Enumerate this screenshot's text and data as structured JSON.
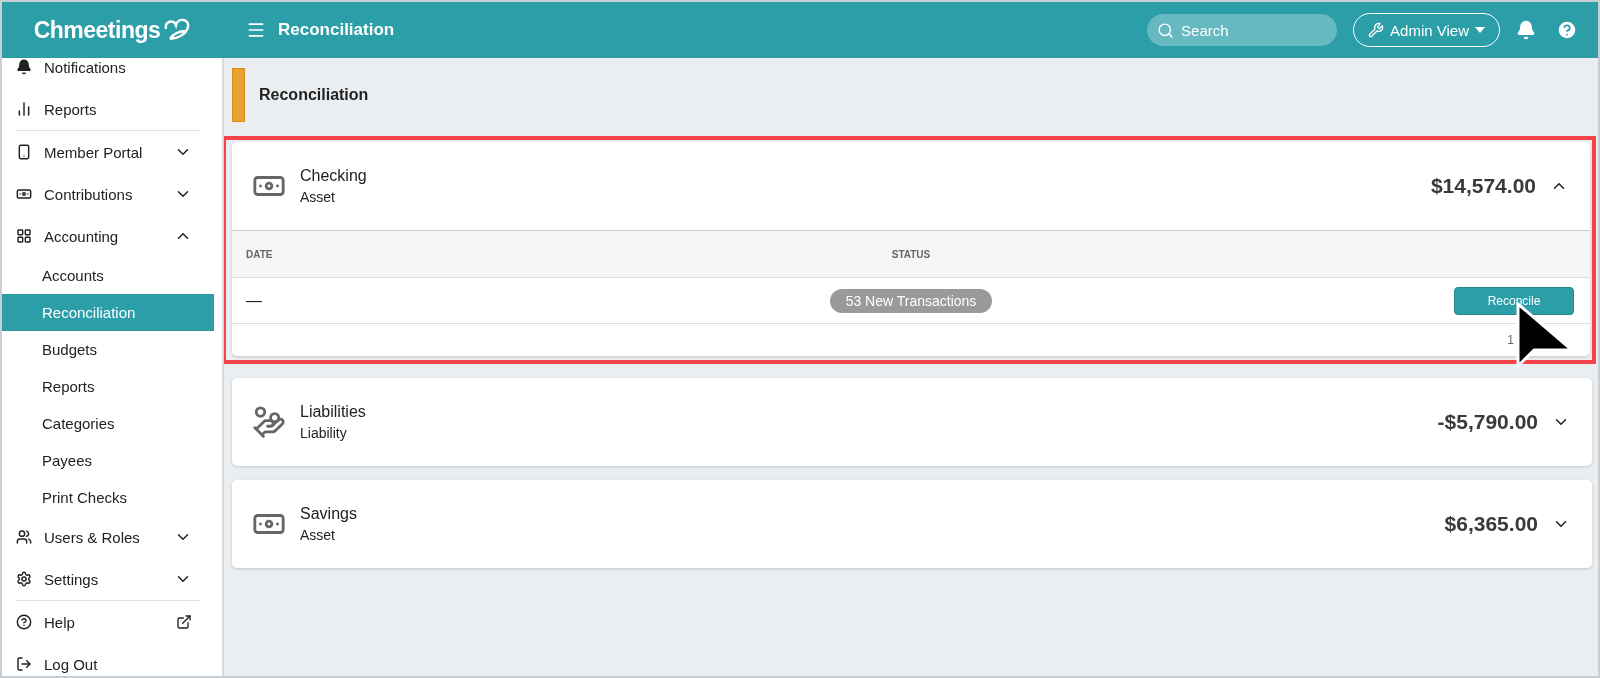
{
  "brand": {
    "name": "Chmeetings"
  },
  "header": {
    "title": "Reconciliation",
    "search": {
      "placeholder": "Search"
    },
    "view_button": "Admin View"
  },
  "sidebar": {
    "items": [
      {
        "label": "Notifications",
        "kind": "item",
        "selected": false
      },
      {
        "label": "Reports",
        "kind": "item",
        "selected": false,
        "divider_after": true
      },
      {
        "label": "Member Portal",
        "kind": "group",
        "expanded": false,
        "selected": false
      },
      {
        "label": "Contributions",
        "kind": "group",
        "expanded": false,
        "selected": false
      },
      {
        "label": "Accounting",
        "kind": "group",
        "expanded": true,
        "selected": false
      },
      {
        "label": "Accounts",
        "kind": "sub",
        "selected": false
      },
      {
        "label": "Reconciliation",
        "kind": "sub",
        "selected": true
      },
      {
        "label": "Budgets",
        "kind": "sub",
        "selected": false
      },
      {
        "label": "Reports",
        "kind": "sub",
        "selected": false
      },
      {
        "label": "Categories",
        "kind": "sub",
        "selected": false
      },
      {
        "label": "Payees",
        "kind": "sub",
        "selected": false
      },
      {
        "label": "Print Checks",
        "kind": "sub",
        "selected": false
      },
      {
        "label": "Users & Roles",
        "kind": "group",
        "expanded": false,
        "selected": false
      },
      {
        "label": "Settings",
        "kind": "group",
        "expanded": false,
        "selected": false,
        "divider_after": true
      },
      {
        "label": "Help",
        "kind": "external",
        "selected": false
      },
      {
        "label": "Log Out",
        "kind": "item",
        "selected": false
      }
    ]
  },
  "page_title": "Reconciliation",
  "accounts": [
    {
      "name": "Checking",
      "type": "Asset",
      "kind": "cash",
      "amount": "$14,574.00",
      "expanded": true,
      "highlighted": true,
      "table": {
        "columns": [
          "DATE",
          "STATUS"
        ],
        "rows": [
          {
            "date": "—",
            "status": "53 New Transactions",
            "action": "Reconcile"
          }
        ],
        "footer": "1"
      }
    },
    {
      "name": "Liabilities",
      "type": "Liability",
      "kind": "hand",
      "amount": "-$5,790.00",
      "expanded": false,
      "highlighted": false
    },
    {
      "name": "Savings",
      "type": "Asset",
      "kind": "cash",
      "amount": "$6,365.00",
      "expanded": false,
      "highlighted": false
    }
  ]
}
